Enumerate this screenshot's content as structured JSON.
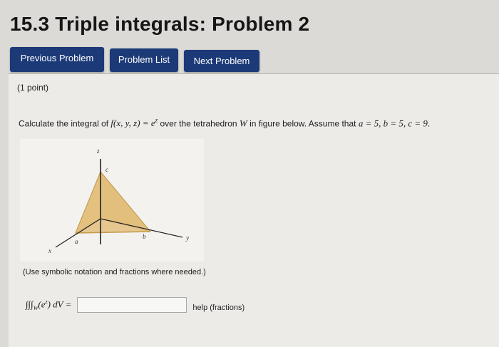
{
  "page": {
    "title": "15.3 Triple integrals: Problem 2"
  },
  "nav": {
    "previous": "Previous Problem",
    "list": "Problem List",
    "next": "Next Problem"
  },
  "problem": {
    "points": "(1 point)",
    "statement_prefix": "Calculate the integral of ",
    "function": "f(x, y, z) = e",
    "function_exp": "z",
    "statement_mid": " over the tetrahedron ",
    "region": "W",
    "statement_suffix": " in figure below. Assume that ",
    "assumptions": "a = 5, b = 5, c = 9",
    "period": ".",
    "hint": "(Use symbolic notation and fractions where needed.)",
    "integral_label": "∫∫∫",
    "integral_sub": "W",
    "integrand": "(e",
    "integrand_exp": "z",
    "integrand_close": ") dV =",
    "answer_value": "",
    "help": "help (fractions)"
  },
  "figure": {
    "axis_x": "x",
    "axis_y": "y",
    "axis_z": "z",
    "point_a": "a",
    "point_b": "b",
    "point_c": "c",
    "fill_color": "#e3c07e",
    "edge_color": "#c49a4c",
    "axis_color": "#222222"
  }
}
